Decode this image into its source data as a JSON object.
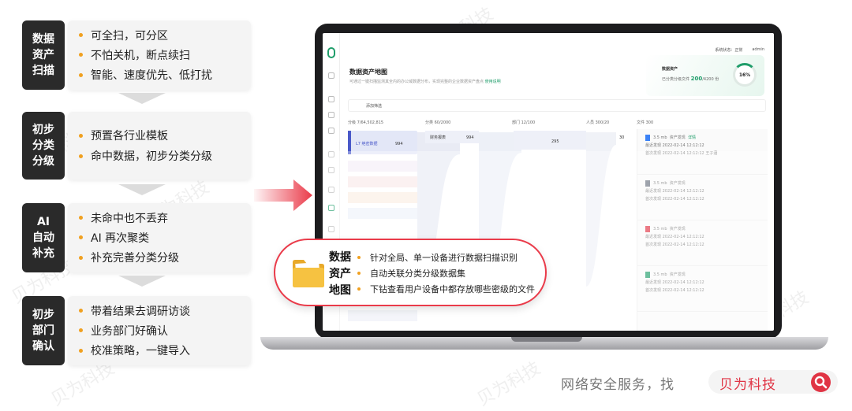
{
  "steps": [
    {
      "title": [
        "数据",
        "资产",
        "扫描"
      ],
      "bullets": [
        "可全扫，可分区",
        "不怕关机，断点续扫",
        "智能、速度优先、低打扰"
      ]
    },
    {
      "title": [
        "初步",
        "分类",
        "分级"
      ],
      "bullets": [
        "预置各行业模板",
        "命中数据，初步分类分级"
      ]
    },
    {
      "title": [
        "AI",
        "自动",
        "补充"
      ],
      "bullets": [
        "未命中也不丢弃",
        "AI 再次聚类",
        "补充完善分类分级"
      ]
    },
    {
      "title": [
        "初步",
        "部门",
        "确认"
      ],
      "bullets": [
        "带着结果去调研访谈",
        "业务部门好确认",
        "校准策略，一键导入"
      ]
    }
  ],
  "screen": {
    "page_title": "数据资产地图",
    "page_desc": "可通过一键扫描监测其全内的办公域数据分布，实现完整的企业数据资产盘点",
    "page_desc_link": "使用说明",
    "status_label": "系统状态：正常",
    "user": "admin",
    "asset_title": "数据资产",
    "asset_desc_prefix": "已分类分级文件",
    "asset_done": "200",
    "asset_total": "/4200 份",
    "progress": "16%",
    "filter_label": "添加筛选",
    "columns": [
      "分级 7/64,502,815",
      "分类 60/2000",
      "部门 12/100",
      "人员 300/20",
      "文件 300"
    ],
    "sankey_nodes": [
      {
        "label": "L7 绝密数据",
        "value": "994"
      },
      {
        "label": "财务报表",
        "value": "994"
      },
      {
        "label": "",
        "value": "295"
      },
      {
        "label": "",
        "value": "30"
      }
    ],
    "files": [
      {
        "size": "3.5 mb",
        "tag": "资产发现",
        "first": "首次发现",
        "date1": "2022-02-14 12:12:12",
        "last": "最近发现",
        "date2": "2022-02-14 12:12:12",
        "owner": "王子涵",
        "detail": "详情"
      },
      {
        "size": "3.5 mb",
        "tag": "资产发现",
        "first": "首次发现",
        "date1": "2022-02-14 12:12:12",
        "last": "最近发现",
        "date2": "2022-02-14 12:12:12",
        "owner": "",
        "detail": ""
      },
      {
        "size": "3.5 mb",
        "tag": "资产发现",
        "first": "首次发现",
        "date1": "2022-02-14 12:12:12",
        "last": "最近发现",
        "date2": "2022-02-14 12:12:12",
        "owner": "",
        "detail": ""
      },
      {
        "size": "3.5 mb",
        "tag": "资产发现",
        "first": "首次发现",
        "date1": "2022-02-14 12:12:12",
        "last": "最近发现",
        "date2": "2022-02-14 12:12:12",
        "owner": "",
        "detail": ""
      }
    ]
  },
  "callout": {
    "title": [
      "数据",
      "资产",
      "地图"
    ],
    "bullets": [
      "针对全局、单一设备进行数据扫描识别",
      "自动关联分类分级数据集",
      "下钻查看用户设备中都存放哪些密级的文件"
    ]
  },
  "watermark": "贝为科技",
  "footer": {
    "slogan": "网络安全服务，找",
    "brand": "贝为科技"
  },
  "colors": {
    "accent_red": "#e03444",
    "bullet_orange": "#f0a020",
    "brand_green": "#1f9d6a"
  }
}
